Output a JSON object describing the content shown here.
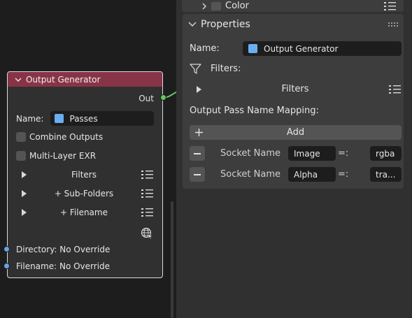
{
  "node": {
    "title": "Output Generator",
    "output_socket": "Out",
    "name_label": "Name:",
    "name_value": "Passes",
    "combine_outputs": "Combine Outputs",
    "multilayer_exr": "Multi-Layer EXR",
    "filters": "Filters",
    "sub_folders": "+ Sub-Folders",
    "filename": "+ Filename",
    "directory_input": "Directory: No Override",
    "filename_input": "Filename: No Override"
  },
  "sidebar": {
    "color_panel": "Color",
    "properties_panel": "Properties",
    "name_label": "Name:",
    "name_value": "Output Generator",
    "filters_label": "Filters:",
    "filters_sub": "Filters",
    "mapping_label": "Output Pass Name Mapping:",
    "add_label": "Add",
    "mappings": [
      {
        "label": "Socket Name",
        "socket": "Image",
        "eq": "=:",
        "value": "rgba"
      },
      {
        "label": "Socket Name",
        "socket": "Alpha",
        "eq": "=:",
        "value": "tra..."
      }
    ]
  },
  "colors": {
    "node_header": "#883448",
    "socket_green": "#63c763",
    "socket_blue": "#6ba1e6",
    "image_icon": "#6aaeef"
  }
}
